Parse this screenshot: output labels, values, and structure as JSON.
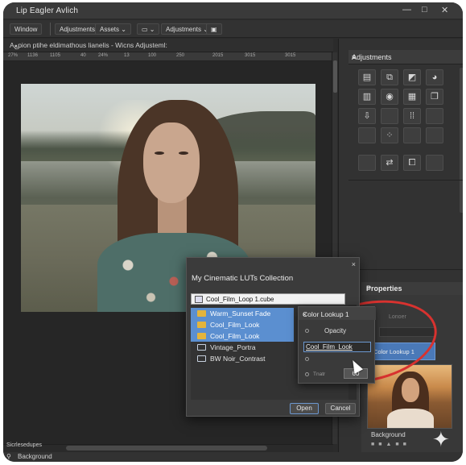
{
  "app": {
    "title": "Lip Eagler Avlich",
    "window_controls": [
      "—",
      "□",
      "✕"
    ]
  },
  "toolbar": {
    "items": [
      "Window",
      "Adjustments",
      "Assets",
      "Adjustments"
    ],
    "dropdown_caret": "⌄"
  },
  "document": {
    "tab_title": "Aﻊpion ptihe eldimathous lianelis - Wicns Adjusteml:",
    "ruler_labels": [
      "27%",
      "1136",
      "1105",
      "40",
      "24%",
      "13",
      "100",
      "250",
      "2015",
      "3015",
      "3015"
    ]
  },
  "adjustments_panel": {
    "title": "Adjustments",
    "menu_icon": "≡",
    "icons": [
      "levels-icon",
      "curves-icon",
      "exposure-icon",
      "vibrance-icon",
      "hue-sat-icon",
      "photo-filter-icon",
      "channel-mixer-icon",
      "color-balance-icon",
      "threshold-icon",
      "blank-icon",
      "grid-icon",
      "blank-icon",
      "blank-icon",
      "invert-icon",
      "blank-icon",
      "blank-icon",
      "posterize-icon",
      "selective-icon",
      "blank-icon"
    ]
  },
  "properties_panel": {
    "title": "Properties",
    "menu_icon": "≡",
    "ghost_label": "Lonoer",
    "selected_layer": "Color Lookup 1",
    "background_label": "Background"
  },
  "lut_dialog": {
    "title": "My Cinematic LUTs Collection",
    "close": "×",
    "filename": "Cool_Film_Loop 1.cube",
    "items": [
      {
        "name": "Warm_Sunset Fade",
        "type": "folder",
        "selected": true
      },
      {
        "name": "Cool_Film_Look",
        "type": "folder",
        "selected": true
      },
      {
        "name": "Cool_Film_Look",
        "type": "folder",
        "selected": true
      },
      {
        "name": "Vintage_Portra",
        "type": "file",
        "selected": false
      },
      {
        "name": "BW Noir_Contrast",
        "type": "file",
        "selected": false
      }
    ],
    "open_label": "Open",
    "cancel_label": "Cancel"
  },
  "color_lookup_popup": {
    "title": "Color Lookup 1",
    "close": "×",
    "opacity_label": "Opacity",
    "lut_value": "Cool_Film_Look",
    "small_label": "Tnatr",
    "value": "60"
  },
  "status": {
    "zoom_label": "Sicrlesedupes",
    "layer": "Background"
  },
  "colors": {
    "accent": "#5b8fd0",
    "highlight_circle": "#d8322f",
    "panel": "#323232"
  }
}
